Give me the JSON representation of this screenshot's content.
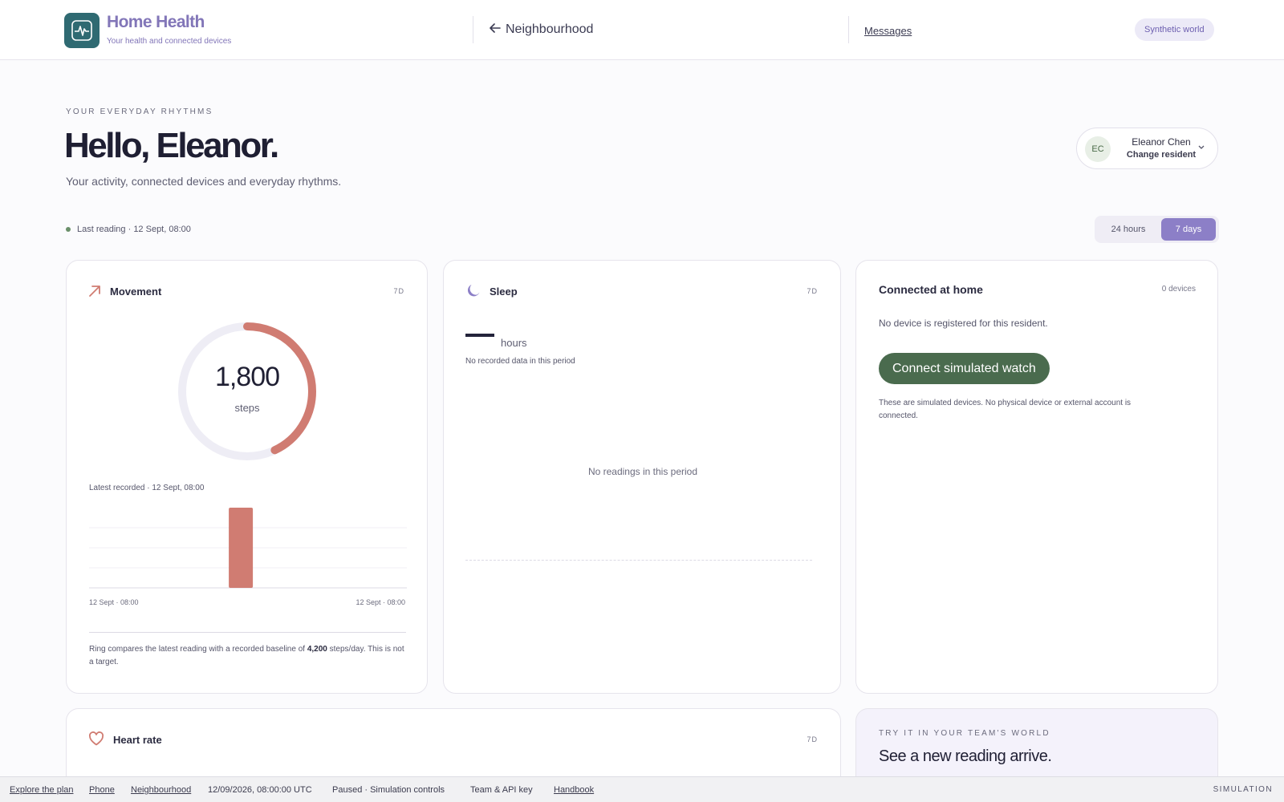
{
  "header": {
    "brand_title": "Home Health",
    "brand_subtitle": "Your health and connected devices",
    "back_label": "Neighbourhood",
    "messages_label": "Messages",
    "world_pill": "Synthetic world"
  },
  "hero": {
    "eyebrow": "YOUR EVERYDAY RHYTHMS",
    "greeting": "Hello, Eleanor.",
    "subtitle": "Your activity, connected devices and everyday rhythms.",
    "last_reading": "Last reading · 12 Sept, 08:00"
  },
  "resident": {
    "initials": "EC",
    "name": "Eleanor Chen",
    "change_label": "Change resident"
  },
  "range": {
    "options": [
      "24 hours",
      "7 days"
    ],
    "selected": "7 days"
  },
  "movement": {
    "title": "Movement",
    "range_tag": "7D",
    "value": "1,800",
    "unit": "steps",
    "ring_fraction": 0.43,
    "latest": "Latest recorded · 12 Sept, 08:00",
    "axis_start": "12 Sept · 08:00",
    "axis_end": "12 Sept · 08:00",
    "note_prefix": "Ring compares the latest reading with a recorded baseline of ",
    "note_value": "4,200",
    "note_suffix": " steps/day. This is not a target."
  },
  "sleep": {
    "title": "Sleep",
    "range_tag": "7D",
    "unit": "hours",
    "no_data": "No recorded data in this period",
    "empty_state": "No readings in this period"
  },
  "connected": {
    "title": "Connected at home",
    "count": "0 devices",
    "text": "No device is registered for this resident.",
    "button": "Connect simulated watch",
    "note": "These are simulated devices. No physical device or external account is connected."
  },
  "heart": {
    "title": "Heart rate",
    "range_tag": "7D"
  },
  "try_it": {
    "eyebrow": "TRY IT IN YOUR TEAM'S WORLD",
    "title": "See a new reading arrive."
  },
  "bottombar": {
    "explore": "Explore the plan",
    "phone": "Phone",
    "neighbourhood": "Neighbourhood",
    "datetime": "12/09/2026, 08:00:00 UTC",
    "status": "Paused · Simulation controls",
    "team": "Team & API key",
    "handbook": "Handbook",
    "mode": "SIMULATION"
  },
  "colors": {
    "brand": "#8276b8",
    "logo_bg": "#2f6a72",
    "accent_coral": "#d07c72",
    "sleep_purple": "#8c7fc7",
    "connect_green": "#4a6b4e"
  },
  "chart_data": {
    "type": "bar",
    "categories": [
      "12 Sept · 08:00"
    ],
    "values": [
      1800
    ],
    "xlabel": "",
    "ylabel": ""
  }
}
